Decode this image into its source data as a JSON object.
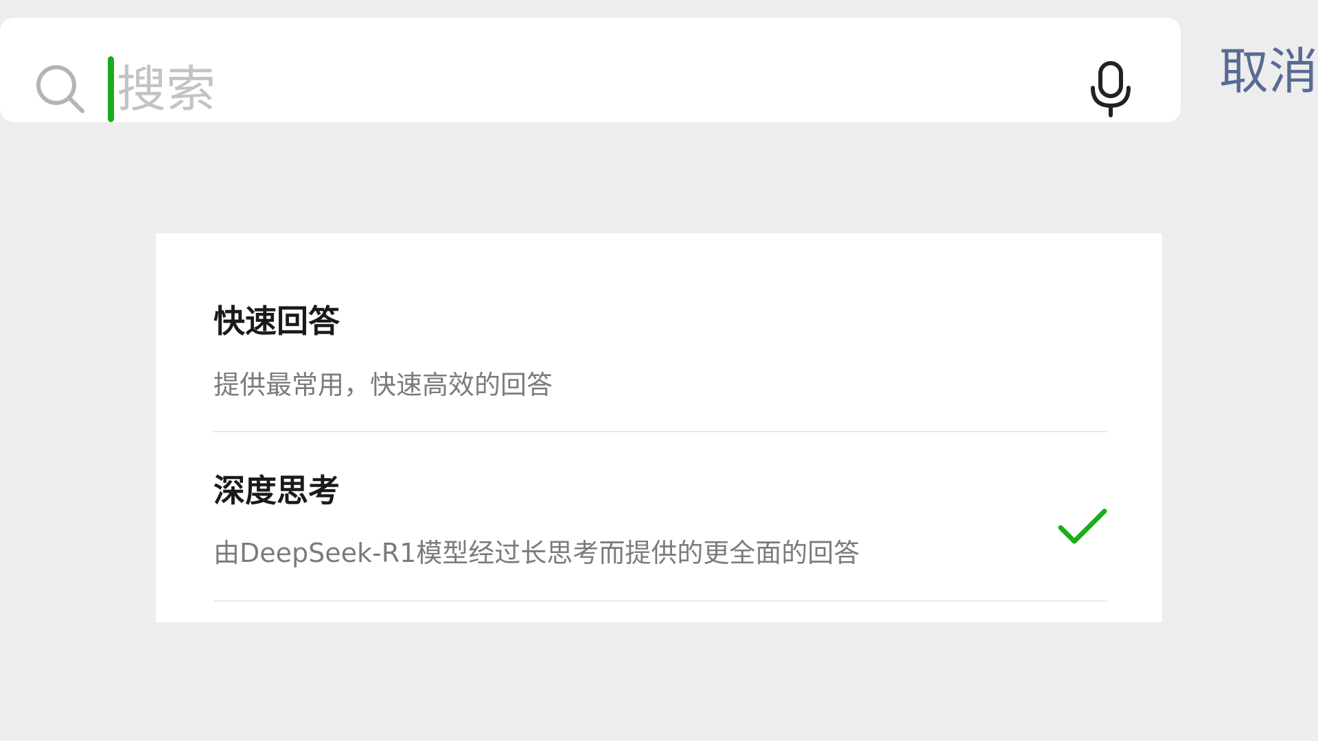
{
  "search": {
    "placeholder": "搜索",
    "value": "",
    "cancel_label": "取消",
    "search_icon": "search-icon",
    "mic_icon": "microphone-icon"
  },
  "modes": [
    {
      "title": "快速回答",
      "description": "提供最常用，快速高效的回答",
      "selected": false
    },
    {
      "title": "深度思考",
      "description": "由DeepSeek-R1模型经过长思考而提供的更全面的回答",
      "selected": true,
      "selected_icon": "checkmark-icon"
    }
  ],
  "colors": {
    "background": "#ededed",
    "card": "#ffffff",
    "accent_green": "#1aad19",
    "cancel_blue": "#576b95",
    "title_text": "#1a1a1a",
    "desc_text": "#7b7b7b",
    "placeholder_text": "#c3c3c3"
  }
}
